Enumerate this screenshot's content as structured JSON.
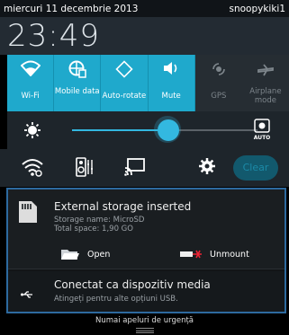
{
  "status_bar": {
    "date": "miercuri 11 decembrie 2013",
    "username": "snoopykiki1"
  },
  "clock": "23:49",
  "quick_settings": [
    {
      "label": "Wi-Fi",
      "icon": "wifi-icon",
      "active": true
    },
    {
      "label": "Mobile data",
      "icon": "mobile-data-icon",
      "active": true
    },
    {
      "label": "Auto-rotate",
      "icon": "auto-rotate-icon",
      "active": true
    },
    {
      "label": "Mute",
      "icon": "mute-icon",
      "active": true
    },
    {
      "label": "GPS",
      "icon": "gps-icon",
      "active": false
    },
    {
      "label": "Airplane mode",
      "icon": "airplane-icon",
      "active": false
    }
  ],
  "brightness": {
    "level": 0.52,
    "auto_label": "AUTO"
  },
  "toolbar": {
    "clear_label": "Clear"
  },
  "notifications": {
    "storage": {
      "title": "External storage inserted",
      "line1": "Storage name: MicroSD",
      "line2": "Total space: 1,90 GO",
      "open_label": "Open",
      "unmount_label": "Unmount"
    },
    "usb": {
      "title": "Conectat ca dispozitiv media",
      "subtitle": "Atingeți pentru alte opțiuni USB."
    }
  },
  "footer": {
    "emergency_text": "Numai apeluri de urgență"
  },
  "colors": {
    "accent": "#1fa9cc",
    "slider": "#33b8e0",
    "border": "#2d6a9f"
  }
}
